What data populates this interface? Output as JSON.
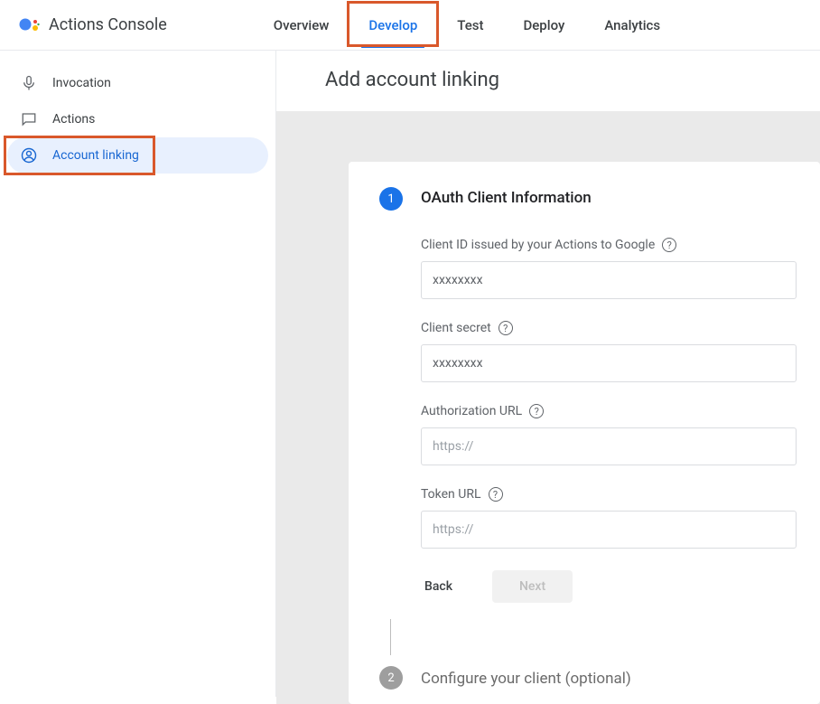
{
  "header": {
    "app_title": "Actions Console"
  },
  "nav": {
    "items": [
      {
        "label": "Overview"
      },
      {
        "label": "Develop"
      },
      {
        "label": "Test"
      },
      {
        "label": "Deploy"
      },
      {
        "label": "Analytics"
      }
    ]
  },
  "sidebar": {
    "items": [
      {
        "label": "Invocation"
      },
      {
        "label": "Actions"
      },
      {
        "label": "Account linking"
      }
    ]
  },
  "page": {
    "title": "Add account linking"
  },
  "form": {
    "step1_num": "1",
    "step1_title": "OAuth Client Information",
    "step2_num": "2",
    "step2_title": "Configure your client (optional)",
    "fields": {
      "client_id": {
        "label": "Client ID issued by your Actions to Google",
        "value": "xxxxxxxx"
      },
      "client_secret": {
        "label": "Client secret",
        "value": "xxxxxxxx"
      },
      "auth_url": {
        "label": "Authorization URL",
        "placeholder": "https://"
      },
      "token_url": {
        "label": "Token URL",
        "placeholder": "https://"
      }
    },
    "buttons": {
      "back": "Back",
      "next": "Next"
    }
  },
  "help_glyph": "?"
}
